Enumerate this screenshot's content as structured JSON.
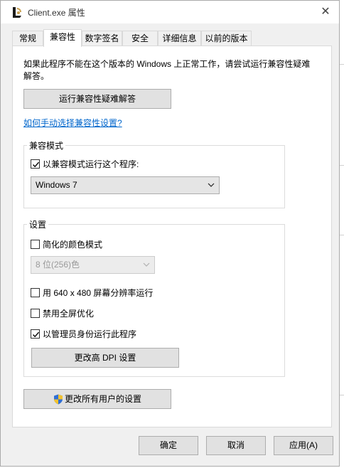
{
  "window": {
    "title": "Client.exe 属性",
    "app_icon": "league-client-icon",
    "close_glyph": "✕"
  },
  "tabs": [
    {
      "label": "常规",
      "active": false
    },
    {
      "label": "兼容性",
      "active": true
    },
    {
      "label": "数字签名",
      "active": false
    },
    {
      "label": "安全",
      "active": false
    },
    {
      "label": "详细信息",
      "active": false
    },
    {
      "label": "以前的版本",
      "active": false
    }
  ],
  "compat": {
    "description": "如果此程序不能在这个版本的 Windows 上正常工作，请尝试运行兼容性疑难解答。",
    "troubleshooter_button": "运行兼容性疑难解答",
    "manual_link": "如何手动选择兼容性设置?",
    "mode_group": {
      "label": "兼容模式",
      "checkbox_label": "以兼容模式运行这个程序:",
      "checked": true,
      "selected_os": "Windows 7"
    },
    "settings_group": {
      "label": "设置",
      "reduced_color_label": "简化的颜色模式",
      "reduced_color_checked": false,
      "color_depth": "8 位(256)色",
      "low_res_label": "用 640 x 480 屏幕分辨率运行",
      "low_res_checked": false,
      "fullscreen_opt_label": "禁用全屏优化",
      "fullscreen_opt_checked": false,
      "admin_label": "以管理员身份运行此程序",
      "admin_checked": true,
      "dpi_button": "更改高 DPI 设置"
    },
    "all_users_button": "更改所有用户的设置"
  },
  "footer": {
    "ok": "确定",
    "cancel": "取消",
    "apply": "应用(A)"
  }
}
